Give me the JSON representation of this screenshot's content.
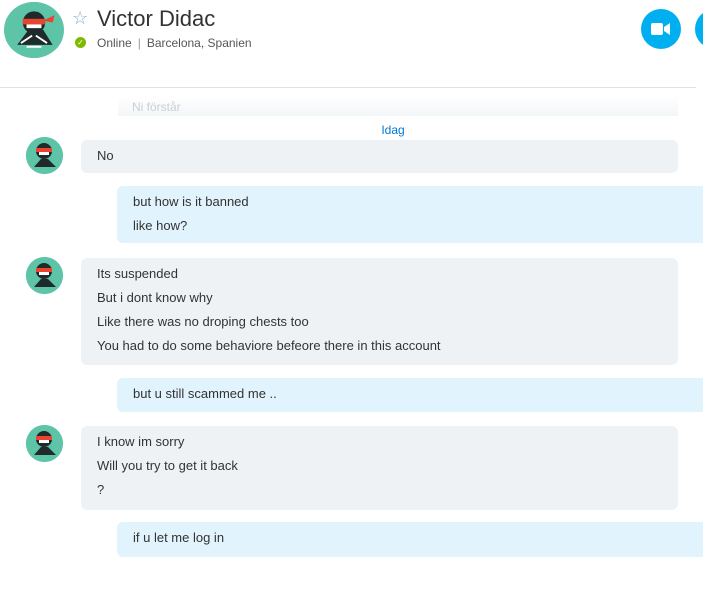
{
  "header": {
    "contact_name": "Victor Didac",
    "status": "Online",
    "location": "Barcelona, Spanien",
    "favorite_icon": "star-outline-icon",
    "video_call_icon": "video-camera-icon",
    "audio_call_icon": "phone-icon"
  },
  "conversation": {
    "partial_message": "Ni förstår",
    "date_separator": "Idag",
    "messages": [
      {
        "direction": "incoming",
        "lines": [
          "No"
        ]
      },
      {
        "direction": "outgoing",
        "lines": [
          "but how is it banned",
          "like how?"
        ]
      },
      {
        "direction": "incoming",
        "lines": [
          "Its suspended",
          "But i dont know why",
          "Like there was no droping chests too",
          "You had to do some behaviore befeore there in this account"
        ]
      },
      {
        "direction": "outgoing",
        "lines": [
          "but u still scammed me .."
        ]
      },
      {
        "direction": "incoming",
        "lines": [
          "I know im sorry",
          "Will you try to get it back",
          "?"
        ]
      },
      {
        "direction": "outgoing",
        "lines": [
          "if u let me log in"
        ]
      }
    ]
  },
  "colors": {
    "accent": "#00aff0",
    "online": "#7fba00",
    "incoming_bubble": "#eff2f5",
    "outgoing_bubble": "#e1f3fc",
    "link": "#0078d4"
  }
}
